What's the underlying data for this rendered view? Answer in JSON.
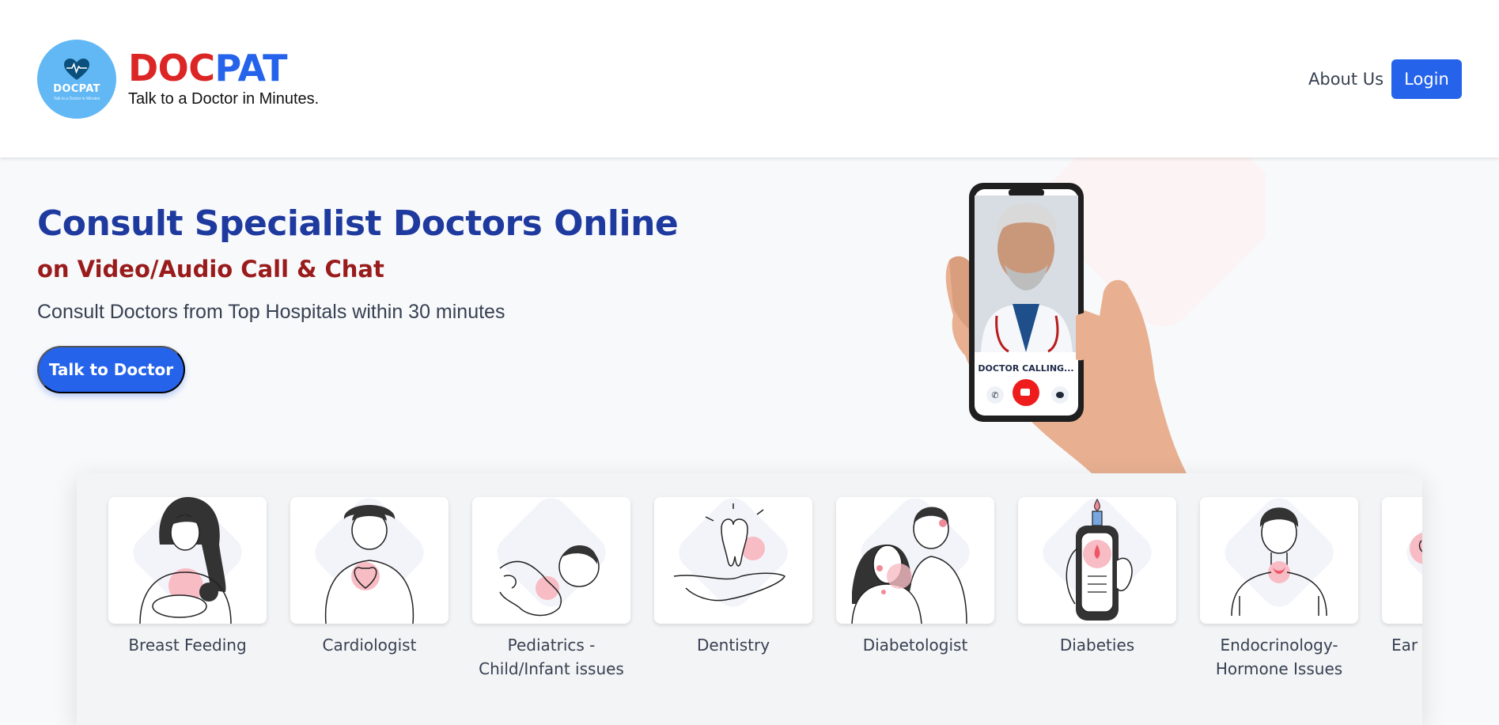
{
  "header": {
    "logo_circle_name": "DOCPAT",
    "logo_circle_tagline": "Talk to a Doctor in Minutes",
    "brand_part1": "DOC",
    "brand_part2": "PAT",
    "tagline": "Talk to a Doctor in Minutes.",
    "nav_about": "About Us",
    "login_label": "Login"
  },
  "hero": {
    "title": "Consult Specialist Doctors Online",
    "subtitle": "on Video/Audio Call & Chat",
    "description": "Consult Doctors from Top Hospitals within 30 minutes",
    "cta_label": "Talk to Doctor",
    "phone_status": "DOCTOR CALLING..."
  },
  "categories": [
    {
      "label": "Breast Feeding",
      "icon": "breast-feeding-icon"
    },
    {
      "label": "Cardiologist",
      "icon": "cardiologist-icon"
    },
    {
      "label": "Pediatrics -\nChild/Infant issues",
      "icon": "pediatrics-icon"
    },
    {
      "label": "Dentistry",
      "icon": "dentistry-icon"
    },
    {
      "label": "Diabetologist",
      "icon": "diabetologist-icon"
    },
    {
      "label": "Diabeties",
      "icon": "diabeties-icon"
    },
    {
      "label": "Endocrinology-\nHormone Issues",
      "icon": "endocrinology-icon"
    },
    {
      "label": "Ear ,",
      "icon": "ear-icon"
    }
  ],
  "colors": {
    "brand_red": "#dc2626",
    "brand_blue": "#2563eb",
    "hero_title": "#1e3a9f",
    "hero_subtitle": "#991b1b",
    "logo_bg": "#62b8f4"
  }
}
